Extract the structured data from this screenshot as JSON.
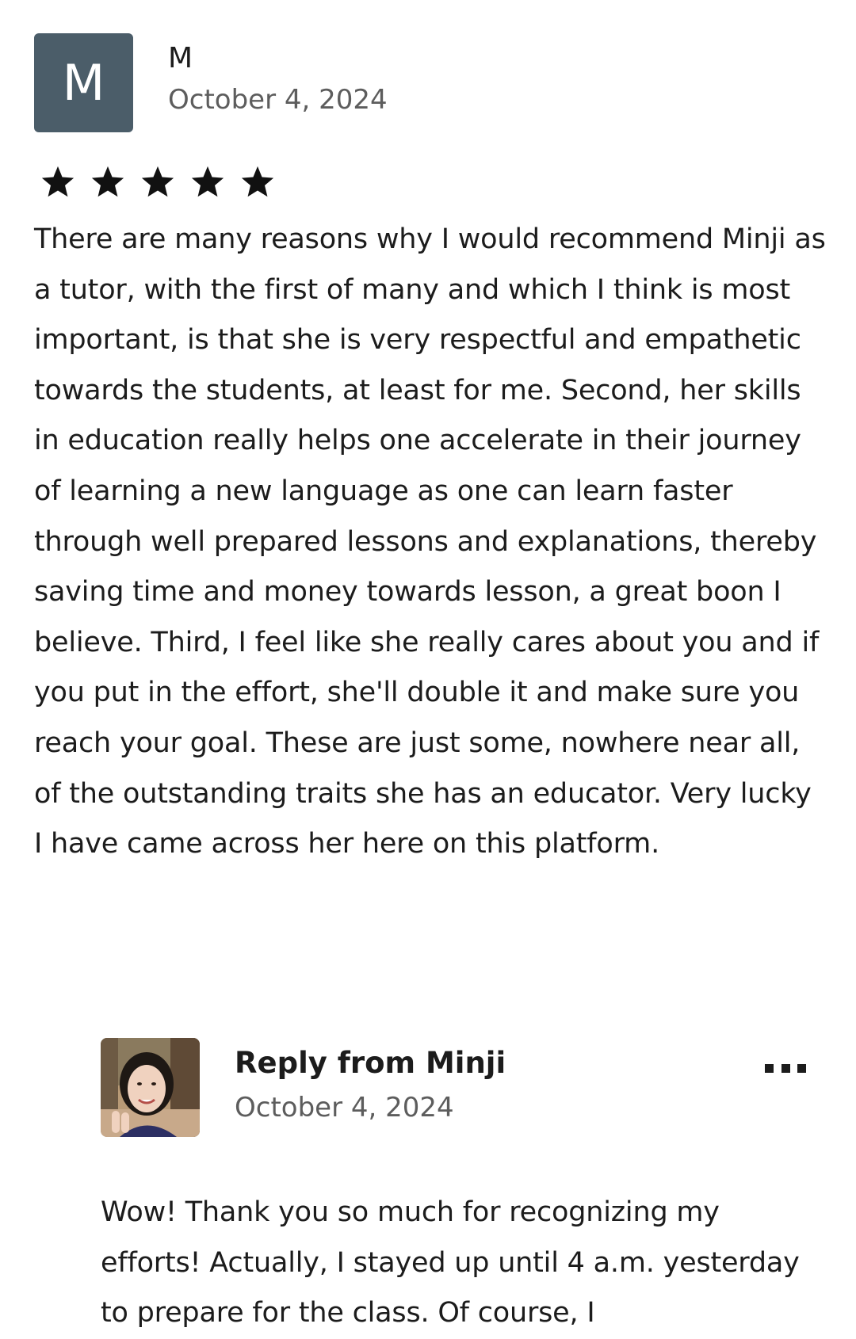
{
  "review": {
    "reviewer_initial": "M",
    "reviewer_name": "M",
    "date": "October 4, 2024",
    "rating": 5,
    "text": "There are many reasons why I would recommend Minji as a tutor, with the first of many and which I think is most important, is that she is very respectful and empathetic towards the students, at least for me. Second, her skills in education really helps one accelerate in their journey of learning a new language as one can learn faster through well prepared lessons and explanations, thereby saving time and money towards lesson, a great boon I believe. Third, I feel like she really cares about you and if you put in the effort, she'll double it and make sure you reach your goal. These are just some, nowhere near all, of the outstanding traits she has an educator. Very lucky I have came across her here on this platform."
  },
  "reply": {
    "title": "Reply from Minji",
    "date": "October 4, 2024",
    "text": "Wow! Thank you so much for recognizing my efforts! Actually, I stayed up until 4 a.m. yesterday to prepare for the class. Of course, I",
    "more_icon": "more-options-icon"
  },
  "colors": {
    "avatar_bg": "#4b5d69",
    "text": "#1c1c1c",
    "muted": "#5d5d5d"
  }
}
